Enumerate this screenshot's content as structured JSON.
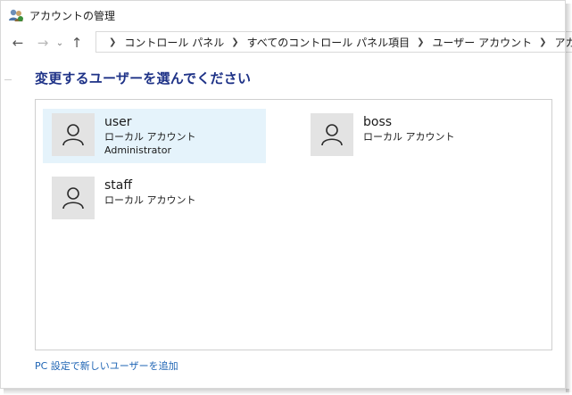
{
  "window": {
    "title": "アカウントの管理"
  },
  "nav": {
    "back_icon": "arrow-left-icon",
    "forward_icon": "arrow-right-icon",
    "recent_icon": "chevron-down-icon",
    "up_icon": "arrow-up-icon"
  },
  "address": {
    "crumbs": [
      "コントロール パネル",
      "すべてのコントロール パネル項目",
      "ユーザー アカウント",
      "アカウントの管理"
    ]
  },
  "main": {
    "heading": "変更するユーザーを選んでください",
    "accounts": [
      {
        "name": "user",
        "type": "ローカル アカウント",
        "role": "Administrator",
        "selected": true
      },
      {
        "name": "boss",
        "type": "ローカル アカウント"
      },
      {
        "name": "staff",
        "type": "ローカル アカウント"
      }
    ]
  },
  "footer": {
    "add_user_link": "PC 設定で新しいユーザーを追加"
  },
  "colors": {
    "heading": "#1e3287",
    "link": "#1e64b4",
    "selected_bg": "#e5f3fb",
    "avatar_bg": "#e3e3e3"
  }
}
